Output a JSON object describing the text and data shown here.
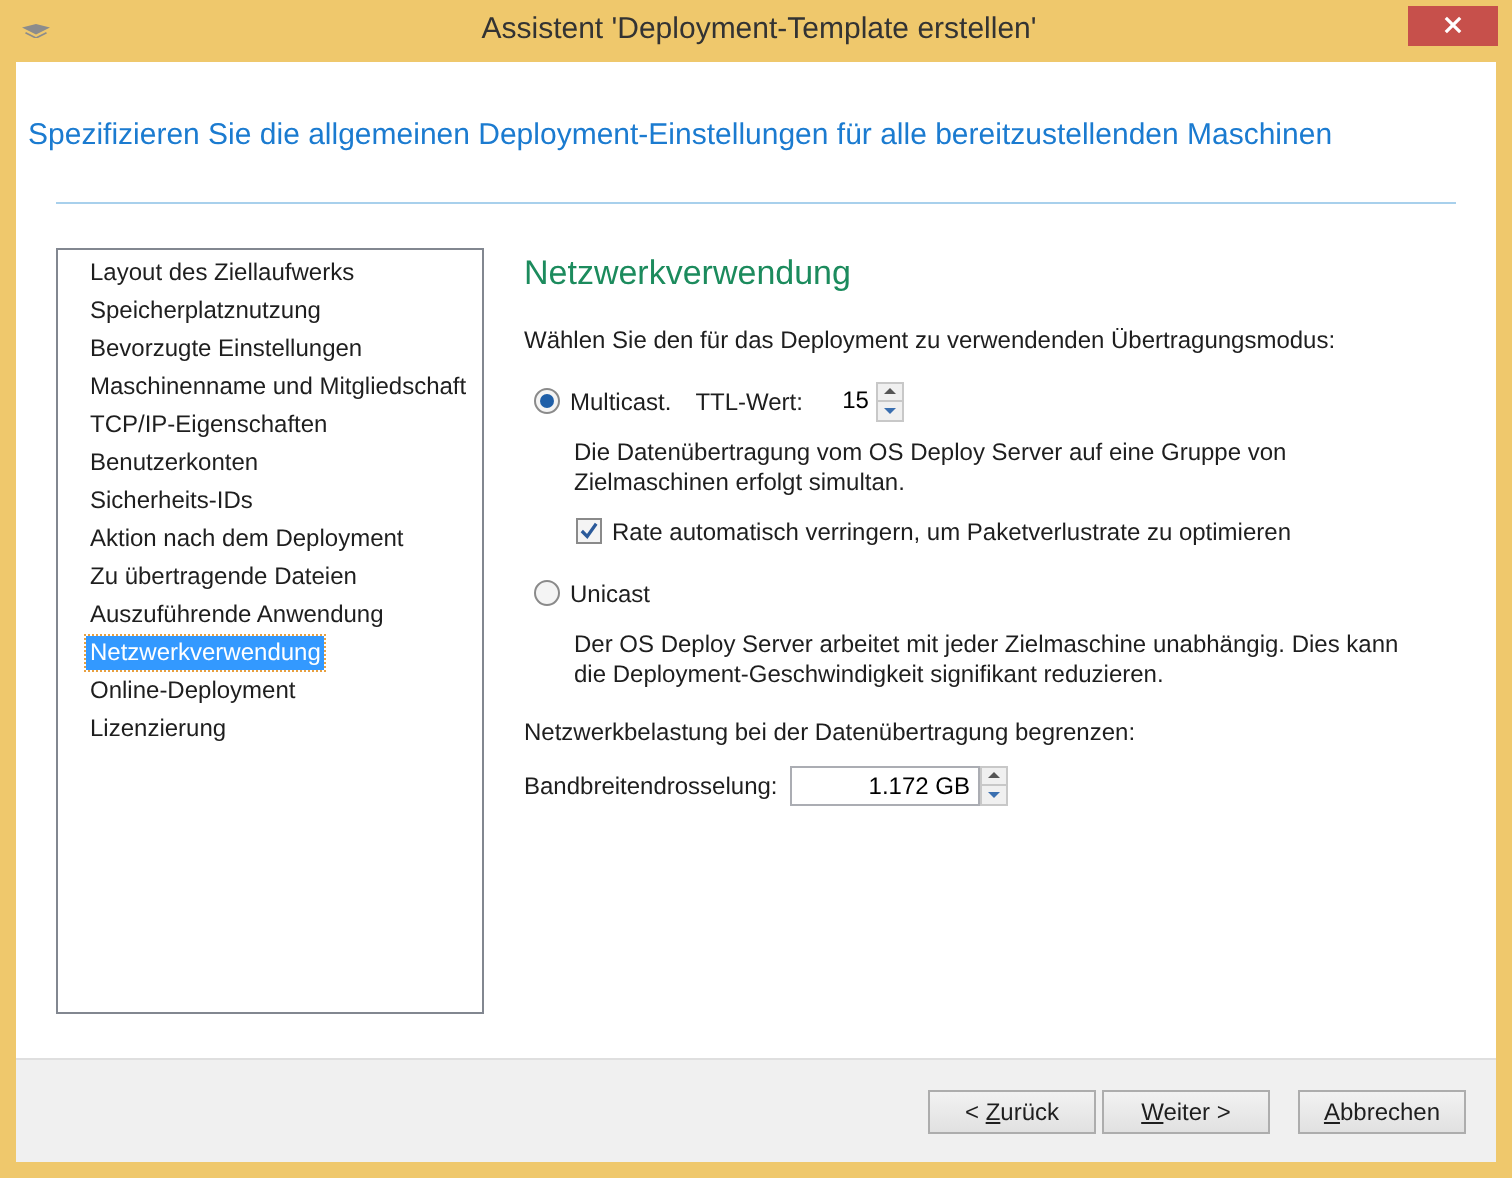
{
  "window": {
    "title": "Assistent 'Deployment-Template erstellen'"
  },
  "header": "Spezifizieren Sie die allgemeinen Deployment-Einstellungen für alle bereitzustellenden Maschinen",
  "steps": [
    {
      "label": "Layout des Ziellaufwerks",
      "selected": false
    },
    {
      "label": "Speicherplatznutzung",
      "selected": false
    },
    {
      "label": "Bevorzugte Einstellungen",
      "selected": false
    },
    {
      "label": "Maschinenname und Mitgliedschaft",
      "selected": false
    },
    {
      "label": "TCP/IP-Eigenschaften",
      "selected": false
    },
    {
      "label": "Benutzerkonten",
      "selected": false
    },
    {
      "label": "Sicherheits-IDs",
      "selected": false
    },
    {
      "label": "Aktion nach dem Deployment",
      "selected": false
    },
    {
      "label": "Zu übertragende Dateien",
      "selected": false
    },
    {
      "label": "Auszuführende Anwendung",
      "selected": false
    },
    {
      "label": "Netzwerkverwendung",
      "selected": true
    },
    {
      "label": "Online-Deployment",
      "selected": false
    },
    {
      "label": "Lizenzierung",
      "selected": false
    }
  ],
  "page": {
    "title": "Netzwerkverwendung",
    "prompt": "Wählen Sie den für das Deployment zu verwendenden Übertragungsmodus:",
    "multicast": {
      "label": "Multicast.",
      "selected": true,
      "ttl_label": "TTL-Wert:",
      "ttl_value": "15",
      "description": "Die Datenübertragung vom OS Deploy Server auf eine Gruppe von Zielmaschinen erfolgt simultan.",
      "auto_rate": {
        "label": "Rate automatisch verringern, um Paketverlustrate zu optimieren",
        "checked": true
      }
    },
    "unicast": {
      "label": "Unicast",
      "selected": false,
      "description": "Der OS Deploy Server arbeitet mit jeder Zielmaschine unabhängig. Dies kann die Deployment-Geschwindigkeit signifikant reduzieren."
    },
    "limit_label": "Netzwerkbelastung bei der Datenübertragung begrenzen:",
    "throttle_label": "Bandbreitendrosselung:",
    "throttle_value": "1.172 GB"
  },
  "buttons": [
    {
      "before": "< ",
      "key": "Z",
      "after": "urück"
    },
    {
      "key": "W",
      "after": "eiter >"
    },
    {
      "key": "A",
      "after": "bbrechen"
    }
  ]
}
